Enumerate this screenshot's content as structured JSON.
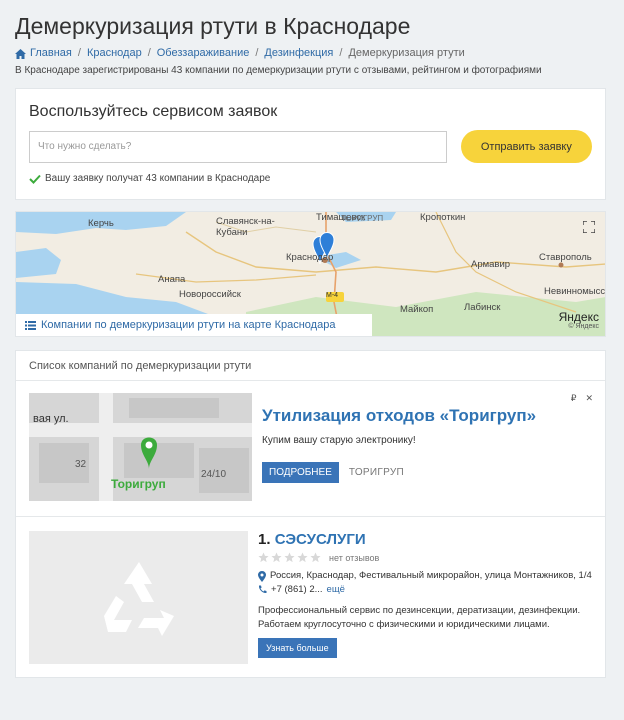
{
  "page": {
    "title": "Демеркуризация ртути в Краснодаре",
    "subtitle": "В Краснодаре зарегистрированы 43 компании по демеркуризации ртути с отзывами, рейтингом и фотографиями"
  },
  "breadcrumb": {
    "home": "Главная",
    "items": [
      "Краснодар",
      "Обеззараживание",
      "Дезинфекция"
    ],
    "current": "Демеркуризация ртути"
  },
  "request": {
    "title": "Воспользуйтесь сервисом заявок",
    "placeholder": "Что нужно сделать?",
    "button": "Отправить заявку",
    "note": "Вашу заявку получат 43 компании в Краснодаре"
  },
  "map": {
    "cities": [
      "Керчь",
      "Славянск-на-Кубани",
      "Тимашевск",
      "Кропоткин",
      "Анапа",
      "Новороссийск",
      "Краснодар",
      "Армавир",
      "Ставрополь",
      "Майкоп",
      "Лабинск",
      "Невинномысск",
      "ТОРИГРУП",
      "М-4"
    ],
    "footer_link": "Компании по демеркуризации ртути на карте Краснодара",
    "provider": "Яндекс",
    "provider_small": "© Яндекс"
  },
  "list": {
    "heading": "Список компаний по демеркуризации ртути"
  },
  "ad": {
    "title": "Утилизация отходов «Торигруп»",
    "text": "Купим вашу старую электронику!",
    "button": "ПОДРОБНЕЕ",
    "brand": "ТОРИГРУП",
    "image_street": "вая ул.",
    "image_num1": "32",
    "image_num2": "24/10",
    "image_label": "Торигруп",
    "corner_mark": "₽",
    "close": "✕"
  },
  "companies": [
    {
      "number": "1.",
      "name": "СЭСУСЛУГИ",
      "reviews": "нет отзывов",
      "address": "Россия, Краснодар, Фестивальный микрорайон, улица Монтажников, 1/4",
      "phone": "+7 (861) 2...",
      "phone_more": "ещё",
      "description": "Профессиональный сервис по дезинсекции, дератизации, дезинфекции. Работаем круглосуточно с физическими и юридическими лицами.",
      "button": "Узнать больше"
    }
  ],
  "colors": {
    "link": "#2f6aa6",
    "accent_yellow": "#f7d33b",
    "button_blue": "#3a74b8",
    "check_green": "#3cab3c"
  }
}
